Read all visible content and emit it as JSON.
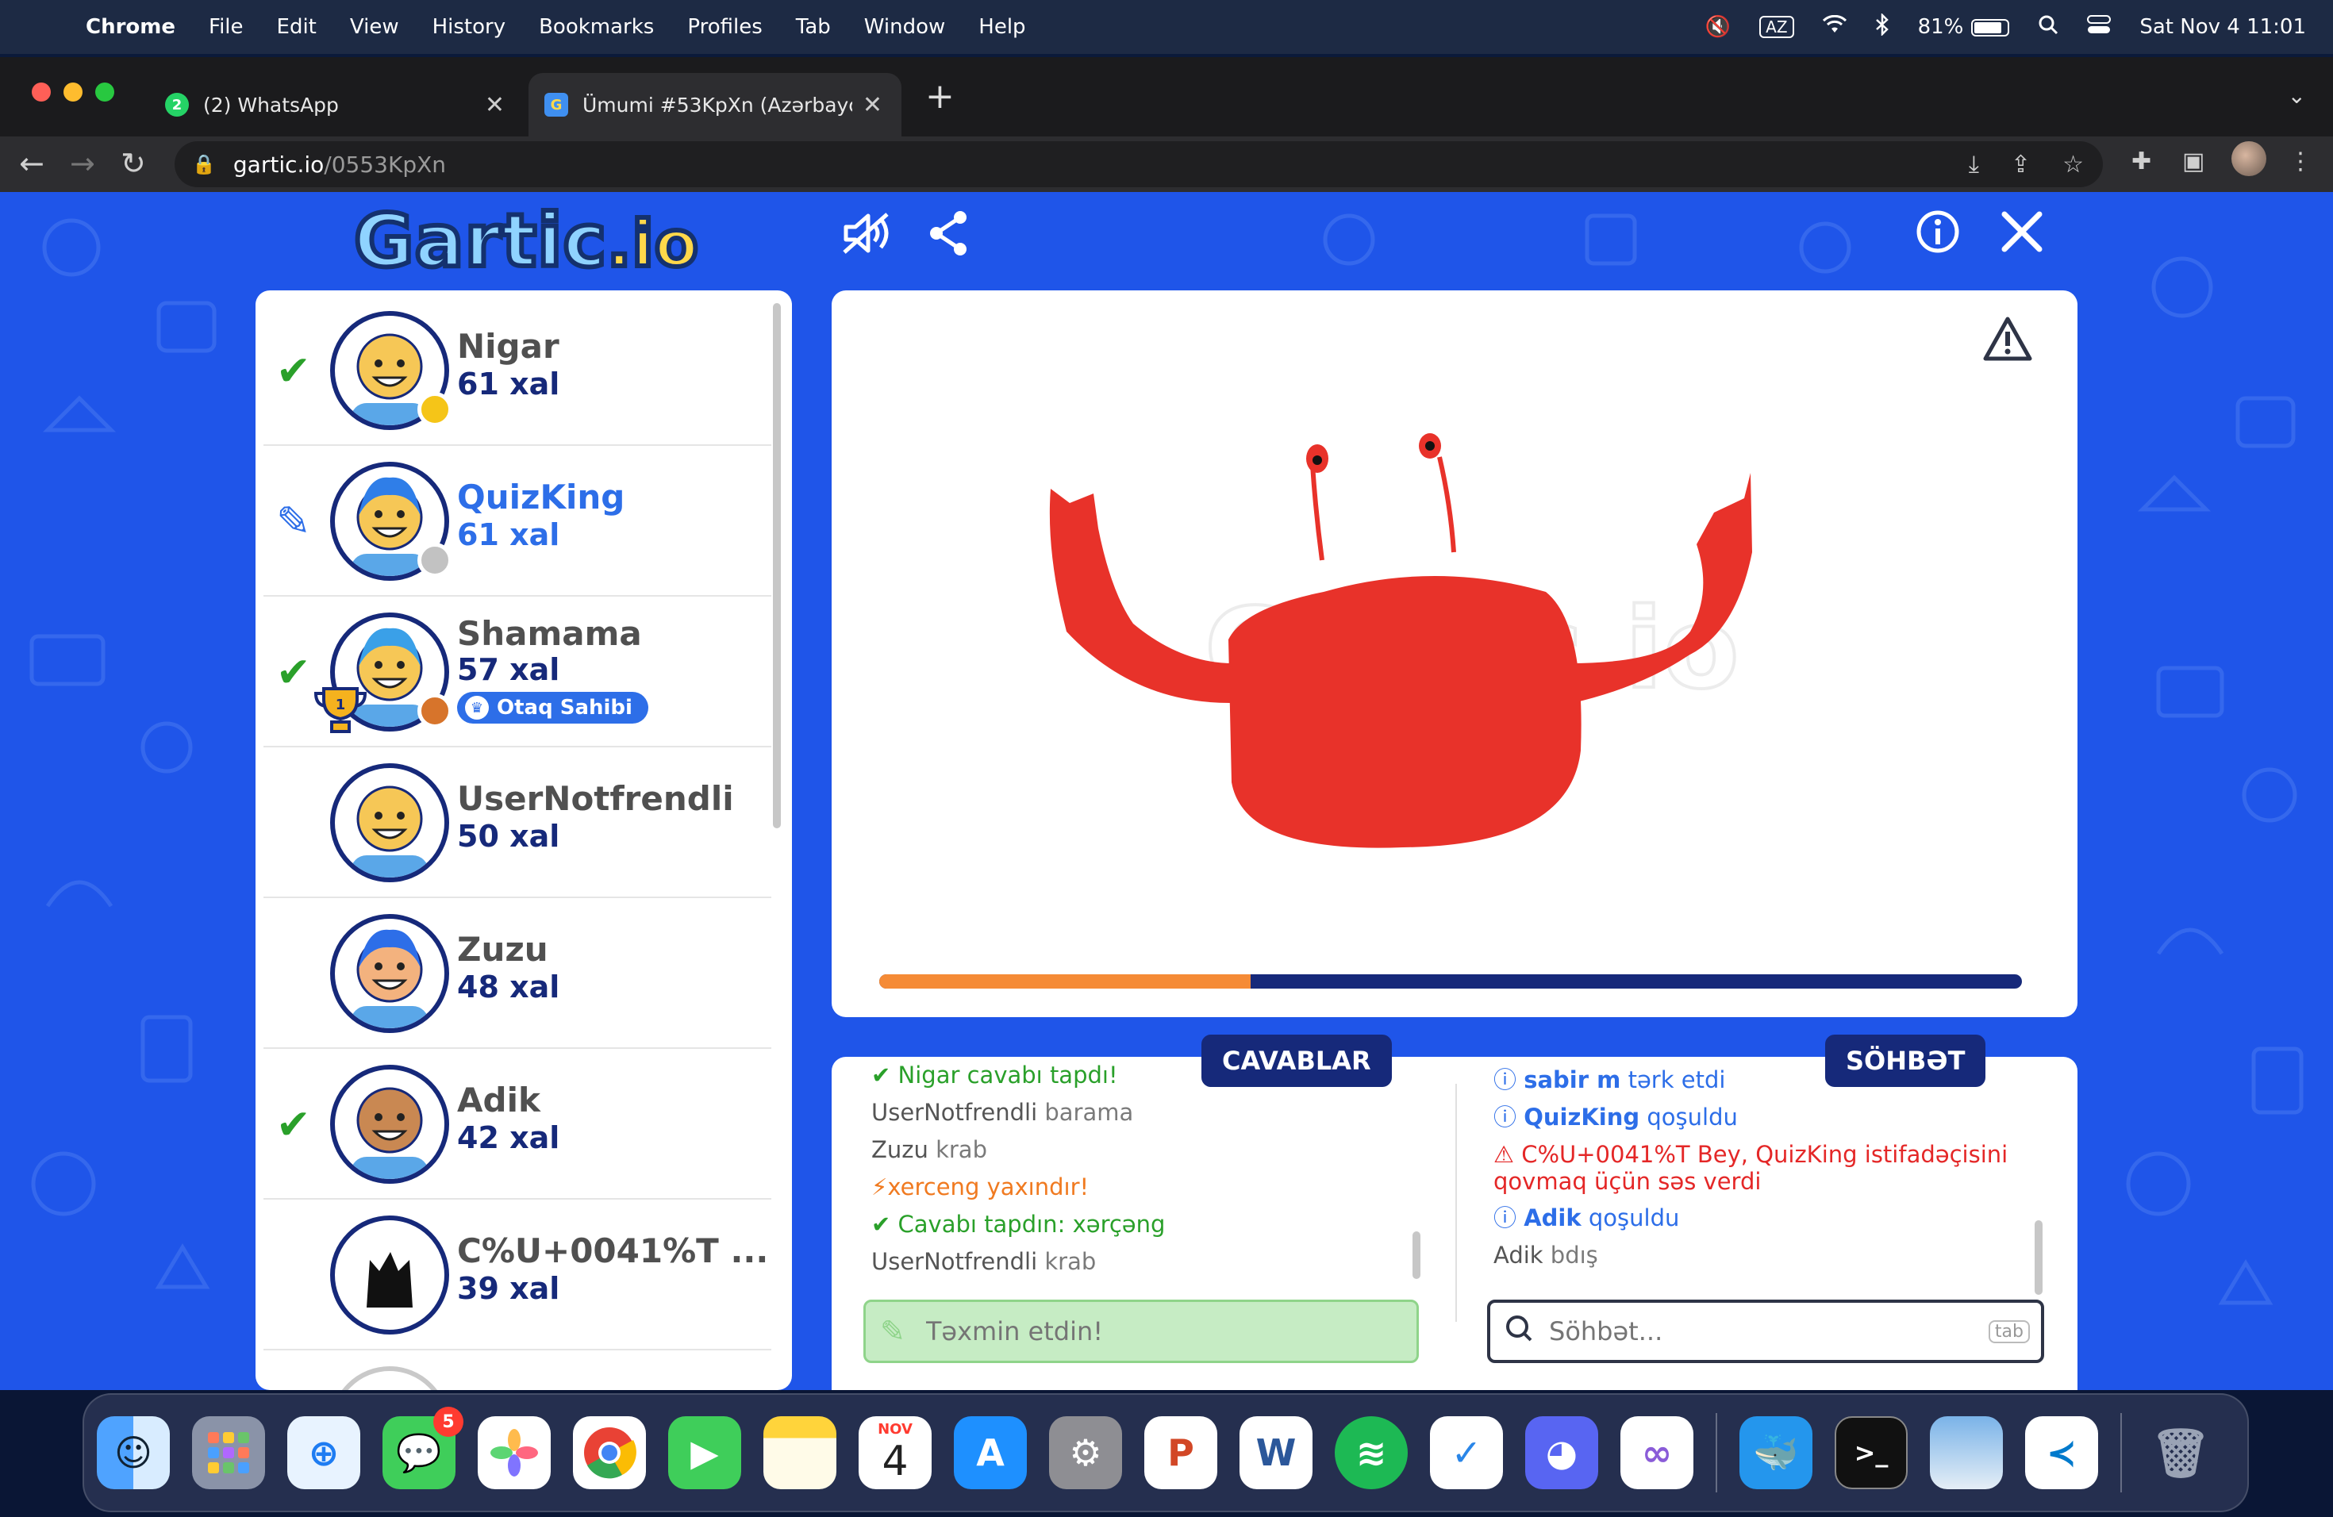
{
  "menubar": {
    "app": "Chrome",
    "items": [
      "File",
      "Edit",
      "View",
      "History",
      "Bookmarks",
      "Profiles",
      "Tab",
      "Window",
      "Help"
    ],
    "keyboard": "AZ",
    "battery": "81%",
    "datetime": "Sat Nov 4  11:01"
  },
  "browser": {
    "tabs": [
      {
        "favicon_text": "2",
        "label": "(2) WhatsApp"
      },
      {
        "favicon_text": "G",
        "label": "Ümumi #53KpXn (Azərbaycan"
      }
    ],
    "url_host": "gartic.io",
    "url_path": "/0553KpXn"
  },
  "game": {
    "logo_main": "Gartic",
    "logo_suffix": ".io",
    "players": [
      {
        "name": "Nigar",
        "points": "61 xal",
        "status": "guessed",
        "dot_color": "#f5c518",
        "skin": "#f6c756",
        "hair": "none"
      },
      {
        "name": "QuizKing",
        "points": "61 xal",
        "status": "drawing",
        "dot_color": "#c2c2c2",
        "skin": "#f6c756",
        "hair": "#2f7ee8"
      },
      {
        "name": "Shamama",
        "points": "57 xal",
        "status": "guessed",
        "dot_color": "#d7742b",
        "skin": "#f6c756",
        "hair": "#3aa0e8",
        "owner_label": "Otaq Sahibi",
        "trophy_rank": "1"
      },
      {
        "name": "UserNotfrendli",
        "points": "50 xal",
        "status": "none",
        "dot_color": "",
        "skin": "#f6c756",
        "hair": "none"
      },
      {
        "name": "Zuzu",
        "points": "48 xal",
        "status": "none",
        "dot_color": "",
        "skin": "#f3b27e",
        "hair": "#2d6ee8"
      },
      {
        "name": "Adik",
        "points": "42 xal",
        "status": "guessed",
        "dot_color": "",
        "skin": "#c98852",
        "hair": "none"
      },
      {
        "name": "C%U+0041%T ...",
        "points": "39 xal",
        "status": "none",
        "dot_color": "",
        "skin": "#ffffff",
        "hair": "black-cat"
      }
    ],
    "timer_progress": 0.325,
    "answers_label": "CAVABLAR",
    "chat_label": "SÖHBƏT",
    "answers": [
      {
        "kind": "green",
        "icon": "check",
        "name": "Nigar",
        "text": " cavabı tapdı!"
      },
      {
        "kind": "plain",
        "name": "UserNotfrendli",
        "text": " barama"
      },
      {
        "kind": "plain",
        "name": "Zuzu",
        "text": " krab"
      },
      {
        "kind": "orange",
        "icon": "bolt",
        "name": "xerceng",
        "text": " yaxındır!"
      },
      {
        "kind": "green",
        "icon": "check",
        "name": "Cavabı tapdın: ",
        "text": "xərçəng"
      },
      {
        "kind": "plain",
        "name": "UserNotfrendli",
        "text": " krab"
      }
    ],
    "answer_placeholder": "Təxmin etdin!",
    "chat": [
      {
        "kind": "info",
        "name": "sabir m",
        "text": " tərk etdi"
      },
      {
        "kind": "info",
        "name": "QuizKing",
        "text": " qoşuldu"
      },
      {
        "kind": "warn",
        "name": "C%U+0041%T Bey",
        "text": ", ",
        "name2": "QuizKing",
        "text2": " istifadəçisini",
        "line2": "qovmaq üçün səs verdi"
      },
      {
        "kind": "info",
        "name": "Adik",
        "text": " qoşuldu"
      },
      {
        "kind": "plain",
        "name": "Adik",
        "text": " bdış"
      }
    ],
    "chat_placeholder": "Söhbət...",
    "chat_key_hint": "tab"
  },
  "dock": {
    "calendar_month": "NOV",
    "calendar_day": "4",
    "messages_badge": "5"
  }
}
